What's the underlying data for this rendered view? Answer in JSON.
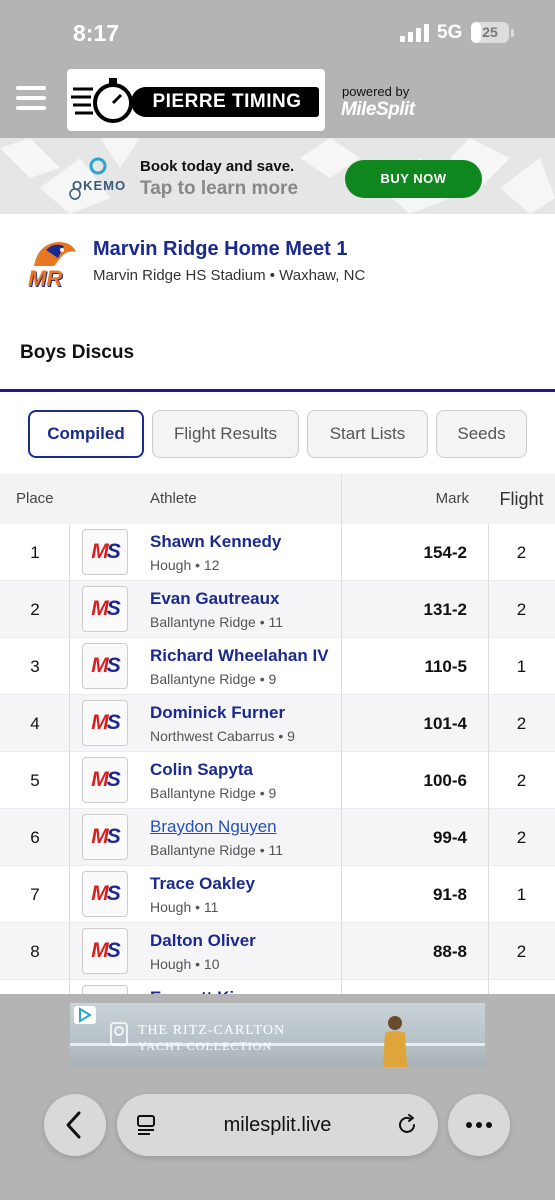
{
  "status_bar": {
    "time": "8:17",
    "network": "5G",
    "battery": "25",
    "battery_level": 0.25
  },
  "header": {
    "logo_text": "PIERRE TIMING",
    "powered_by": "powered by",
    "brand": "MileSplit"
  },
  "ad_banner": {
    "logo_text": "OKEMO",
    "title": "Book today and save.",
    "subtitle": "Tap to learn more",
    "button": "BUY NOW"
  },
  "meet": {
    "logo_text": "MR",
    "name": "Marvin Ridge Home Meet 1",
    "location": "Marvin Ridge HS Stadium • Waxhaw, NC"
  },
  "event": {
    "name": "Boys Discus"
  },
  "tabs": [
    {
      "label": "Compiled",
      "active": true
    },
    {
      "label": "Flight Results",
      "active": false
    },
    {
      "label": "Start Lists",
      "active": false
    },
    {
      "label": "Seeds",
      "active": false
    }
  ],
  "table": {
    "headers": {
      "place": "Place",
      "athlete": "Athlete",
      "mark": "Mark",
      "flight": "Flight"
    },
    "rows": [
      {
        "place": "1",
        "badge": "MS",
        "name": "Shawn Kennedy",
        "meta": "Hough • 12",
        "mark": "154-2",
        "flight": "2"
      },
      {
        "place": "2",
        "badge": "MS",
        "name": "Evan Gautreaux",
        "meta": "Ballantyne Ridge • 11",
        "mark": "131-2",
        "flight": "2"
      },
      {
        "place": "3",
        "badge": "MS",
        "name": "Richard Wheelahan IV",
        "meta": "Ballantyne Ridge • 9",
        "mark": "110-5",
        "flight": "1"
      },
      {
        "place": "4",
        "badge": "MS",
        "name": "Dominick Furner",
        "meta": "Northwest Cabarrus • 9",
        "mark": "101-4",
        "flight": "2"
      },
      {
        "place": "5",
        "badge": "MS",
        "name": "Colin Sapyta",
        "meta": "Ballantyne Ridge • 9",
        "mark": "100-6",
        "flight": "2"
      },
      {
        "place": "6",
        "badge": "MS",
        "name": "Braydon Nguyen",
        "meta": "Ballantyne Ridge • 11",
        "mark": "99-4",
        "flight": "2"
      },
      {
        "place": "7",
        "badge": "MS",
        "name": "Trace Oakley",
        "meta": "Hough • 11",
        "mark": "91-8",
        "flight": "1"
      },
      {
        "place": "8",
        "badge": "MS",
        "name": "Dalton Oliver",
        "meta": "Hough • 10",
        "mark": "88-8",
        "flight": "2"
      },
      {
        "place": "",
        "badge": "",
        "name": "Emmett King",
        "meta": "",
        "mark": "",
        "flight": ""
      }
    ]
  },
  "bottom_ad": {
    "title": "THE RITZ-CARLTON",
    "subtitle": "YACHT COLLECTION"
  },
  "browser": {
    "url": "milesplit.live",
    "back_icon": "chevron-left-icon",
    "menu_icon": "ellipsis-icon"
  }
}
